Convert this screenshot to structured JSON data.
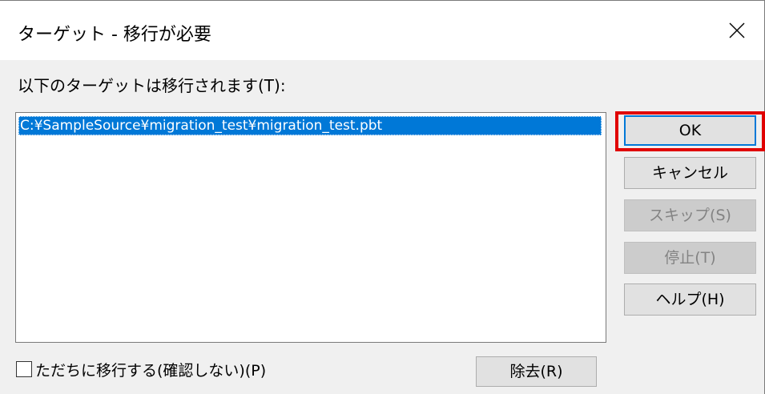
{
  "window": {
    "title": "ターゲット - 移行が必要",
    "close_icon": "close-icon"
  },
  "prompt": "以下のターゲットは移行されます(T):",
  "target_list": {
    "items": [
      {
        "path": "C:¥SampleSource¥migration_test¥migration_test.pbt",
        "selected": true
      }
    ]
  },
  "buttons": {
    "ok": "OK",
    "cancel": "キャンセル",
    "skip": "スキップ(S)",
    "stop": "停止(T)",
    "help": "ヘルプ(H)",
    "remove": "除去(R)"
  },
  "disabled": [
    "skip",
    "stop"
  ],
  "checkbox": {
    "label": "ただちに移行する(確認しない)(P)",
    "checked": false
  },
  "highlight": {
    "target": "ok-button",
    "color": "#e00000"
  },
  "colors": {
    "selection": "#0078d7",
    "dialog_bg": "#f0f0f0",
    "default_button_border": "#0078d7"
  }
}
